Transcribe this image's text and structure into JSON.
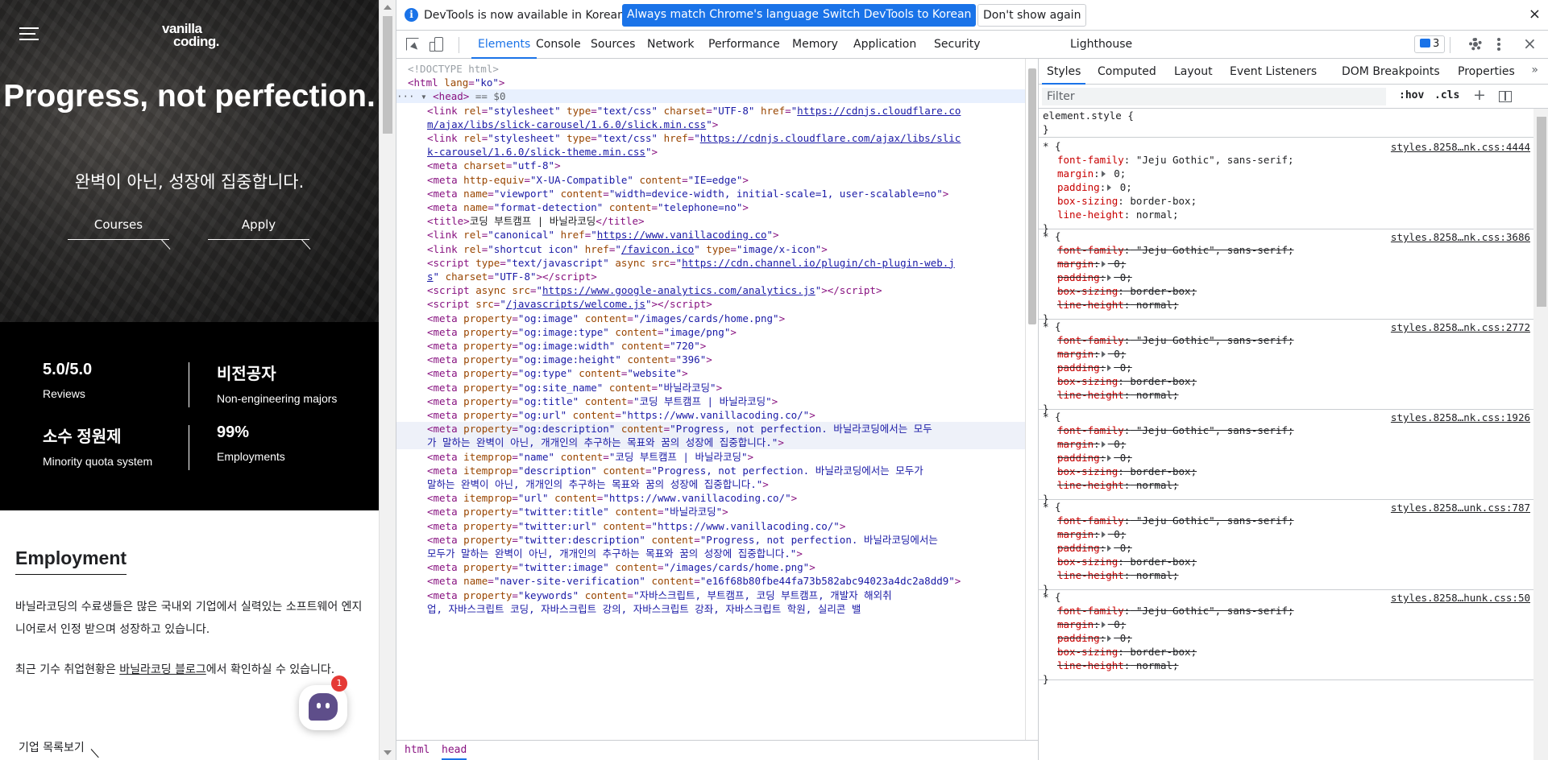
{
  "site": {
    "logo_line1": "vanilla",
    "logo_line2": "coding.",
    "hero_title": "Progress, not perfection.",
    "hero_subtitle": "완벽이 아닌, 성장에 집중합니다.",
    "btn_courses": "Courses",
    "btn_apply": "Apply",
    "stats": [
      {
        "value": "5.0/5.0",
        "label": "Reviews"
      },
      {
        "value": "비전공자",
        "label": "Non-engineering majors"
      },
      {
        "value": "소수 정원제",
        "label": "Minority quota system"
      },
      {
        "value": "99%",
        "label": "Employments"
      }
    ],
    "employment_title": "Employment",
    "employment_p1": "바닐라코딩의 수료생들은 많은 국내외 기업에서 실력있는 소프트웨어 엔지니어로서 인정 받으며 성장하고 있습니다.",
    "employment_p2_pre": "최근 기수 취업현황은 ",
    "employment_p2_link": "바닐라코딩 블로그",
    "employment_p2_post": "에서 확인하실 수 있습니다.",
    "company_link": "기업 목록보기",
    "chat_badge": "1"
  },
  "devtools": {
    "infobar": {
      "text": "DevTools is now available in Korean!",
      "btn_match": "Always match Chrome's language",
      "btn_switch": "Switch DevTools to Korean",
      "btn_dismiss": "Don't show again",
      "close": "×"
    },
    "tabs": [
      "Elements",
      "Console",
      "Sources",
      "Network",
      "Performance",
      "Memory",
      "Application",
      "Security",
      "Lighthouse"
    ],
    "active_tab": "Elements",
    "issues_count": "3",
    "close": "×",
    "breadcrumbs": [
      "html",
      "head"
    ],
    "styles_tabs": [
      "Styles",
      "Computed",
      "Layout",
      "Event Listeners",
      "DOM Breakpoints",
      "Properties"
    ],
    "styles_more": "»",
    "filter_placeholder": "Filter",
    "hov": ":hov",
    "cls": ".cls",
    "plus": "+",
    "element_style": "element.style {",
    "element_style_close": "}",
    "rules": [
      {
        "selector": "* {",
        "source": "styles.8258…nk.css:4444",
        "struck": false
      },
      {
        "selector": "* {",
        "source": "styles.8258…nk.css:3686",
        "struck": true
      },
      {
        "selector": "* {",
        "source": "styles.8258…nk.css:2772",
        "struck": true
      },
      {
        "selector": "* {",
        "source": "styles.8258…nk.css:1926",
        "struck": true
      },
      {
        "selector": "* {",
        "source": "styles.8258…unk.css:787",
        "struck": true
      },
      {
        "selector": "* {",
        "source": "styles.8258…hunk.css:50",
        "struck": true
      }
    ],
    "props": [
      {
        "name": "font-family",
        "value": " \"Jeju Gothic\", sans-serif;"
      },
      {
        "name": "margin",
        "value": " 0;"
      },
      {
        "name": "padding",
        "value": " 0;"
      },
      {
        "name": "box-sizing",
        "value": " border-box;"
      },
      {
        "name": "line-height",
        "value": " normal;"
      }
    ],
    "dom_lines": [
      {
        "indent": 0,
        "html": "<span class=\"cm\">&lt;!DOCTYPE html&gt;</span>"
      },
      {
        "indent": 0,
        "html": "<span class=\"tg\">&lt;html</span> <span class=\"an\">lang</span><span class=\"tg\">=</span><span class=\"av\">\"ko\"</span><span class=\"tg\">&gt;</span>"
      },
      {
        "indent": 0,
        "sel": true,
        "html": "<span class=\"dim\">··· ▾ </span><span class=\"tg\">&lt;head&gt;</span><span class=\"dim\"> == $0</span>"
      },
      {
        "indent": 3,
        "html": "<span class=\"tg\">&lt;link</span> <span class=\"an\">rel</span><span class=\"tg\">=</span><span class=\"av\">\"stylesheet\"</span> <span class=\"an\">type</span><span class=\"tg\">=</span><span class=\"av\">\"text/css\"</span> <span class=\"an\">charset</span><span class=\"tg\">=</span><span class=\"av\">\"UTF-8\"</span> <span class=\"an\">href</span><span class=\"tg\">=</span><span class=\"av\">\"</span><span class=\"lk\">https://cdnjs.cloudflare.co</span>"
      },
      {
        "indent": 3,
        "html": "<span class=\"lk\">m/ajax/libs/slick-carousel/1.6.0/slick.min.css</span><span class=\"av\">\"</span><span class=\"tg\">&gt;</span>"
      },
      {
        "indent": 3,
        "html": "<span class=\"tg\">&lt;link</span> <span class=\"an\">rel</span><span class=\"tg\">=</span><span class=\"av\">\"stylesheet\"</span> <span class=\"an\">type</span><span class=\"tg\">=</span><span class=\"av\">\"text/css\"</span> <span class=\"an\">href</span><span class=\"tg\">=</span><span class=\"av\">\"</span><span class=\"lk\">https://cdnjs.cloudflare.com/ajax/libs/slic</span>"
      },
      {
        "indent": 3,
        "html": "<span class=\"lk\">k-carousel/1.6.0/slick-theme.min.css</span><span class=\"av\">\"</span><span class=\"tg\">&gt;</span>"
      },
      {
        "indent": 3,
        "html": "<span class=\"tg\">&lt;meta</span> <span class=\"an\">charset</span><span class=\"tg\">=</span><span class=\"av\">\"utf-8\"</span><span class=\"tg\">&gt;</span>"
      },
      {
        "indent": 3,
        "html": "<span class=\"tg\">&lt;meta</span> <span class=\"an\">http-equiv</span><span class=\"tg\">=</span><span class=\"av\">\"X-UA-Compatible\"</span> <span class=\"an\">content</span><span class=\"tg\">=</span><span class=\"av\">\"IE=edge\"</span><span class=\"tg\">&gt;</span>"
      },
      {
        "indent": 3,
        "html": "<span class=\"tg\">&lt;meta</span> <span class=\"an\">name</span><span class=\"tg\">=</span><span class=\"av\">\"viewport\"</span> <span class=\"an\">content</span><span class=\"tg\">=</span><span class=\"av\">\"width=device-width, initial-scale=1, user-scalable=no\"</span><span class=\"tg\">&gt;</span>"
      },
      {
        "indent": 3,
        "html": "<span class=\"tg\">&lt;meta</span> <span class=\"an\">name</span><span class=\"tg\">=</span><span class=\"av\">\"format-detection\"</span> <span class=\"an\">content</span><span class=\"tg\">=</span><span class=\"av\">\"telephone=no\"</span><span class=\"tg\">&gt;</span>"
      },
      {
        "indent": 3,
        "html": "<span class=\"tg\">&lt;title&gt;</span><span class=\"tx\">코딩 부트캠프 | 바닐라코딩</span><span class=\"tg\">&lt;/title&gt;</span>"
      },
      {
        "indent": 3,
        "html": "<span class=\"tg\">&lt;link</span> <span class=\"an\">rel</span><span class=\"tg\">=</span><span class=\"av\">\"canonical\"</span> <span class=\"an\">href</span><span class=\"tg\">=</span><span class=\"av\">\"</span><span class=\"lk\">https://www.vanillacoding.co</span><span class=\"av\">\"</span><span class=\"tg\">&gt;</span>"
      },
      {
        "indent": 3,
        "html": "<span class=\"tg\">&lt;link</span> <span class=\"an\">rel</span><span class=\"tg\">=</span><span class=\"av\">\"shortcut icon\"</span> <span class=\"an\">href</span><span class=\"tg\">=</span><span class=\"av\">\"</span><span class=\"lk\">/favicon.ico</span><span class=\"av\">\"</span> <span class=\"an\">type</span><span class=\"tg\">=</span><span class=\"av\">\"image/x-icon\"</span><span class=\"tg\">&gt;</span>"
      },
      {
        "indent": 3,
        "html": "<span class=\"tg\">&lt;script</span> <span class=\"an\">type</span><span class=\"tg\">=</span><span class=\"av\">\"text/javascript\"</span> <span class=\"an\">async</span> <span class=\"an\">src</span><span class=\"tg\">=</span><span class=\"av\">\"</span><span class=\"lk\">https://cdn.channel.io/plugin/ch-plugin-web.j</span>"
      },
      {
        "indent": 3,
        "html": "<span class=\"lk\">s</span><span class=\"av\">\"</span> <span class=\"an\">charset</span><span class=\"tg\">=</span><span class=\"av\">\"UTF-8\"</span><span class=\"tg\">&gt;&lt;/script&gt;</span>"
      },
      {
        "indent": 3,
        "html": "<span class=\"tg\">&lt;script</span> <span class=\"an\">async</span> <span class=\"an\">src</span><span class=\"tg\">=</span><span class=\"av\">\"</span><span class=\"lk\">https://www.google-analytics.com/analytics.js</span><span class=\"av\">\"</span><span class=\"tg\">&gt;&lt;/script&gt;</span>"
      },
      {
        "indent": 3,
        "html": "<span class=\"tg\">&lt;script</span> <span class=\"an\">src</span><span class=\"tg\">=</span><span class=\"av\">\"</span><span class=\"lk\">/javascripts/welcome.js</span><span class=\"av\">\"</span><span class=\"tg\">&gt;&lt;/script&gt;</span>"
      },
      {
        "indent": 3,
        "html": "<span class=\"tg\">&lt;meta</span> <span class=\"an\">property</span><span class=\"tg\">=</span><span class=\"av\">\"og:image\"</span> <span class=\"an\">content</span><span class=\"tg\">=</span><span class=\"av\">\"/images/cards/home.png\"</span><span class=\"tg\">&gt;</span>"
      },
      {
        "indent": 3,
        "html": "<span class=\"tg\">&lt;meta</span> <span class=\"an\">property</span><span class=\"tg\">=</span><span class=\"av\">\"og:image:type\"</span> <span class=\"an\">content</span><span class=\"tg\">=</span><span class=\"av\">\"image/png\"</span><span class=\"tg\">&gt;</span>"
      },
      {
        "indent": 3,
        "html": "<span class=\"tg\">&lt;meta</span> <span class=\"an\">property</span><span class=\"tg\">=</span><span class=\"av\">\"og:image:width\"</span> <span class=\"an\">content</span><span class=\"tg\">=</span><span class=\"av\">\"720\"</span><span class=\"tg\">&gt;</span>"
      },
      {
        "indent": 3,
        "html": "<span class=\"tg\">&lt;meta</span> <span class=\"an\">property</span><span class=\"tg\">=</span><span class=\"av\">\"og:image:height\"</span> <span class=\"an\">content</span><span class=\"tg\">=</span><span class=\"av\">\"396\"</span><span class=\"tg\">&gt;</span>"
      },
      {
        "indent": 3,
        "html": "<span class=\"tg\">&lt;meta</span> <span class=\"an\">property</span><span class=\"tg\">=</span><span class=\"av\">\"og:type\"</span> <span class=\"an\">content</span><span class=\"tg\">=</span><span class=\"av\">\"website\"</span><span class=\"tg\">&gt;</span>"
      },
      {
        "indent": 3,
        "html": "<span class=\"tg\">&lt;meta</span> <span class=\"an\">property</span><span class=\"tg\">=</span><span class=\"av\">\"og:site_name\"</span> <span class=\"an\">content</span><span class=\"tg\">=</span><span class=\"av\">\"바닐라코딩\"</span><span class=\"tg\">&gt;</span>"
      },
      {
        "indent": 3,
        "html": "<span class=\"tg\">&lt;meta</span> <span class=\"an\">property</span><span class=\"tg\">=</span><span class=\"av\">\"og:title\"</span> <span class=\"an\">content</span><span class=\"tg\">=</span><span class=\"av\">\"코딩 부트캠프 | 바닐라코딩\"</span><span class=\"tg\">&gt;</span>"
      },
      {
        "indent": 3,
        "html": "<span class=\"tg\">&lt;meta</span> <span class=\"an\">property</span><span class=\"tg\">=</span><span class=\"av\">\"og:url\"</span> <span class=\"an\">content</span><span class=\"tg\">=</span><span class=\"av\">\"https://www.vanillacoding.co/\"</span><span class=\"tg\">&gt;</span>"
      },
      {
        "indent": 3,
        "hl": true,
        "html": "<span class=\"tg\">&lt;meta</span> <span class=\"an\">property</span><span class=\"tg\">=</span><span class=\"av\">\"og:description\"</span> <span class=\"an\">content</span><span class=\"tg\">=</span><span class=\"av\">\"Progress, not perfection. 바닐라코딩에서는 모두</span>"
      },
      {
        "indent": 3,
        "hl": true,
        "html": "<span class=\"av\">가 말하는 완벽이 아닌, 개개인의 추구하는 목표와 꿈의 성장에 집중합니다.\"</span><span class=\"tg\">&gt;</span>"
      },
      {
        "indent": 3,
        "html": "<span class=\"tg\">&lt;meta</span> <span class=\"an\">itemprop</span><span class=\"tg\">=</span><span class=\"av\">\"name\"</span> <span class=\"an\">content</span><span class=\"tg\">=</span><span class=\"av\">\"코딩 부트캠프 | 바닐라코딩\"</span><span class=\"tg\">&gt;</span>"
      },
      {
        "indent": 3,
        "html": "<span class=\"tg\">&lt;meta</span> <span class=\"an\">itemprop</span><span class=\"tg\">=</span><span class=\"av\">\"description\"</span> <span class=\"an\">content</span><span class=\"tg\">=</span><span class=\"av\">\"Progress, not perfection. 바닐라코딩에서는 모두가</span>"
      },
      {
        "indent": 3,
        "html": "<span class=\"av\">말하는 완벽이 아닌, 개개인의 추구하는 목표와 꿈의 성장에 집중합니다.\"</span><span class=\"tg\">&gt;</span>"
      },
      {
        "indent": 3,
        "html": "<span class=\"tg\">&lt;meta</span> <span class=\"an\">itemprop</span><span class=\"tg\">=</span><span class=\"av\">\"url\"</span> <span class=\"an\">content</span><span class=\"tg\">=</span><span class=\"av\">\"https://www.vanillacoding.co/\"</span><span class=\"tg\">&gt;</span>"
      },
      {
        "indent": 3,
        "html": "<span class=\"tg\">&lt;meta</span> <span class=\"an\">property</span><span class=\"tg\">=</span><span class=\"av\">\"twitter:title\"</span> <span class=\"an\">content</span><span class=\"tg\">=</span><span class=\"av\">\"바닐라코딩\"</span><span class=\"tg\">&gt;</span>"
      },
      {
        "indent": 3,
        "html": "<span class=\"tg\">&lt;meta</span> <span class=\"an\">property</span><span class=\"tg\">=</span><span class=\"av\">\"twitter:url\"</span> <span class=\"an\">content</span><span class=\"tg\">=</span><span class=\"av\">\"https://www.vanillacoding.co/\"</span><span class=\"tg\">&gt;</span>"
      },
      {
        "indent": 3,
        "html": "<span class=\"tg\">&lt;meta</span> <span class=\"an\">property</span><span class=\"tg\">=</span><span class=\"av\">\"twitter:description\"</span> <span class=\"an\">content</span><span class=\"tg\">=</span><span class=\"av\">\"Progress, not perfection. 바닐라코딩에서는</span>"
      },
      {
        "indent": 3,
        "html": "<span class=\"av\">모두가 말하는 완벽이 아닌, 개개인의 추구하는 목표와 꿈의 성장에 집중합니다.\"</span><span class=\"tg\">&gt;</span>"
      },
      {
        "indent": 3,
        "html": "<span class=\"tg\">&lt;meta</span> <span class=\"an\">property</span><span class=\"tg\">=</span><span class=\"av\">\"twitter:image\"</span> <span class=\"an\">content</span><span class=\"tg\">=</span><span class=\"av\">\"/images/cards/home.png\"</span><span class=\"tg\">&gt;</span>"
      },
      {
        "indent": 3,
        "html": "<span class=\"tg\">&lt;meta</span> <span class=\"an\">name</span><span class=\"tg\">=</span><span class=\"av\">\"naver-site-verification\"</span> <span class=\"an\">content</span><span class=\"tg\">=</span><span class=\"av\">\"e16f68b80fbe44fa73b582abc94023a4dc2a8dd9\"</span><span class=\"tg\">&gt;</span>"
      },
      {
        "indent": 3,
        "html": "<span class=\"tg\">&lt;meta</span> <span class=\"an\">property</span><span class=\"tg\">=</span><span class=\"av\">\"keywords\"</span> <span class=\"an\">content</span><span class=\"tg\">=</span><span class=\"av\">\"자바스크립트, 부트캠프, 코딩 부트캠프, 개발자 해외취</span>"
      },
      {
        "indent": 3,
        "html": "<span class=\"av\">업, 자바스크립트 코딩, 자바스크립트 강의, 자바스크립트 강좌, 자바스크립트 학원, 실리콘 밸</span>"
      }
    ]
  }
}
